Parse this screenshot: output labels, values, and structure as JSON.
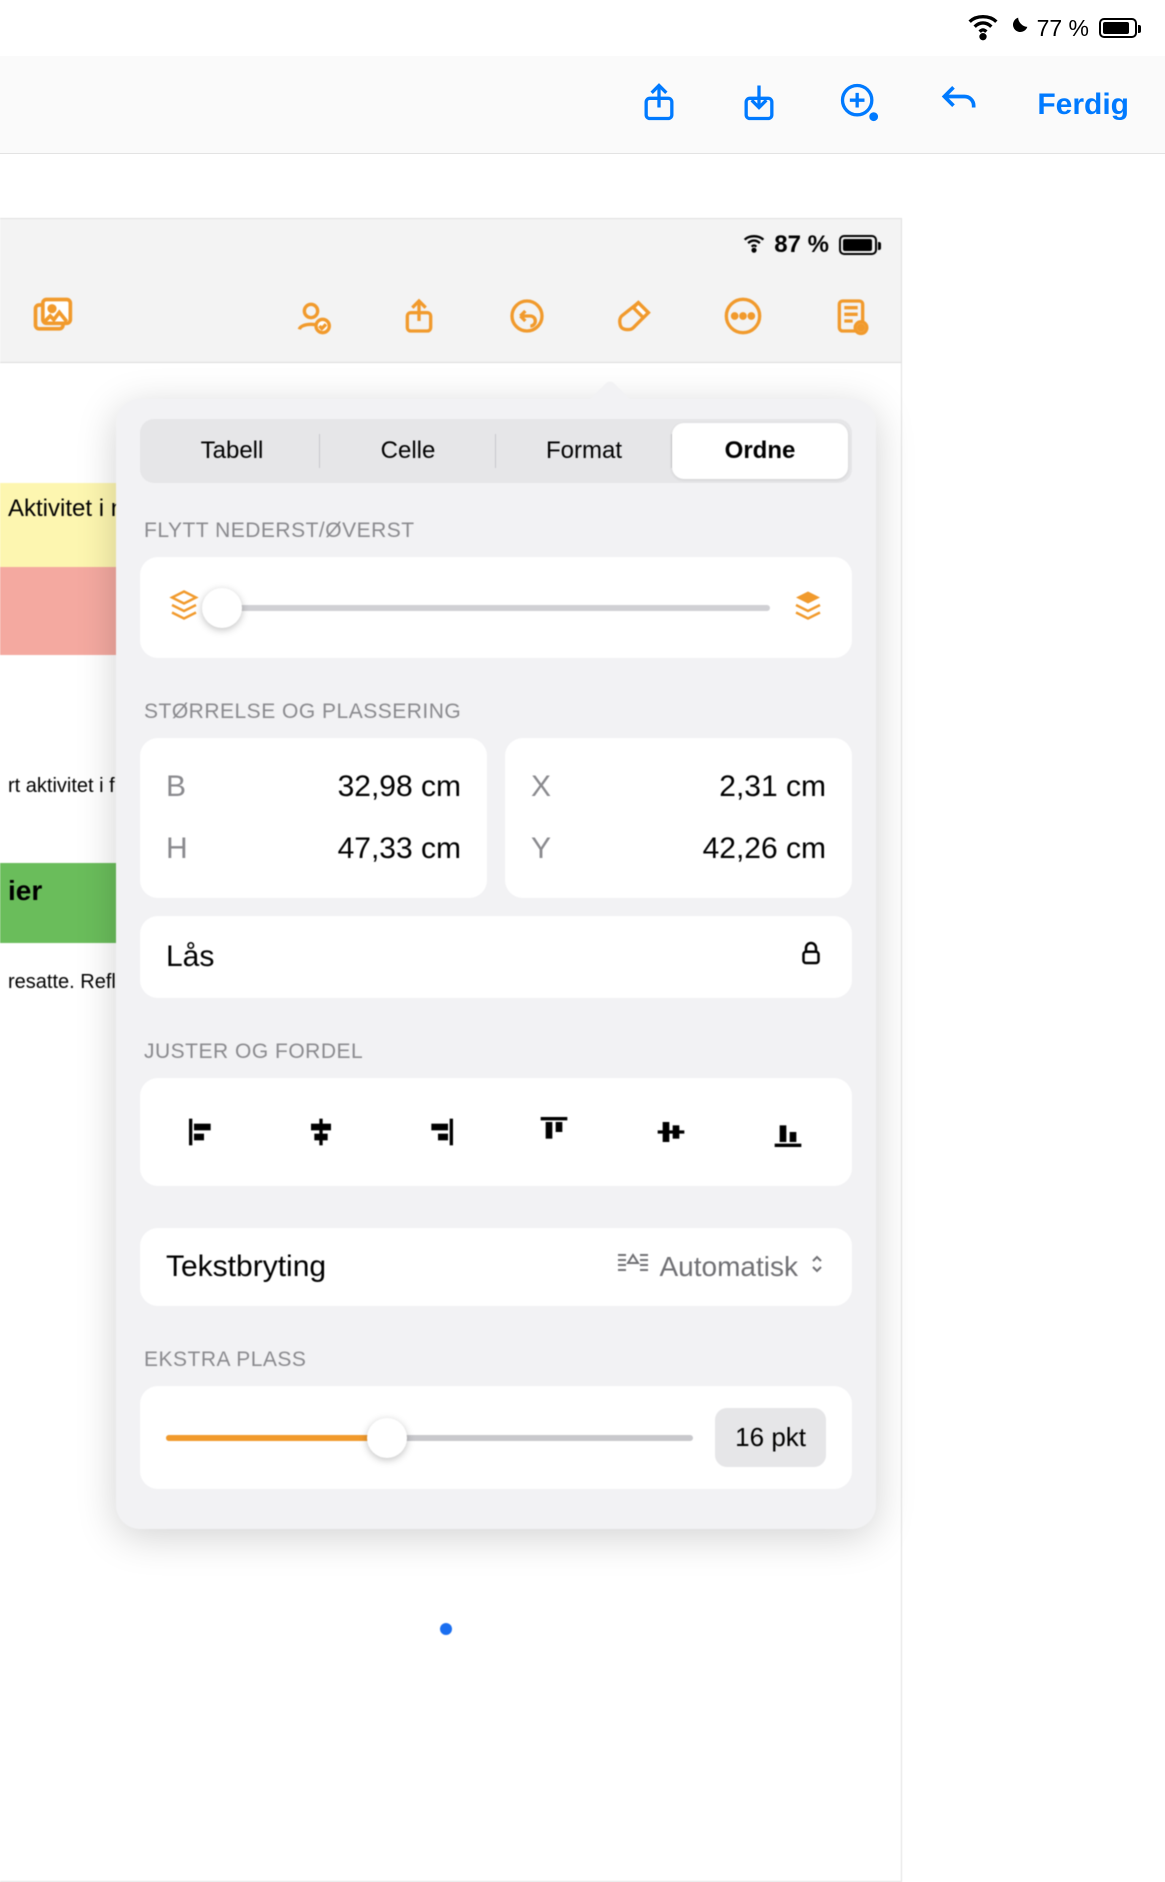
{
  "outer": {
    "battery_pct": "77 %",
    "done_label": "Ferdig"
  },
  "inner": {
    "battery_pct": "87 %"
  },
  "popover": {
    "tabs": [
      "Tabell",
      "Celle",
      "Format",
      "Ordne"
    ],
    "selected_tab_index": 3,
    "move_section_label": "FLYTT NEDERST/ØVERST",
    "size_section_label": "STØRRELSE OG PLASSERING",
    "size": {
      "width_key": "B",
      "width_val": "32,98 cm",
      "height_key": "H",
      "height_val": "47,33 cm",
      "x_key": "X",
      "x_val": "2,31 cm",
      "y_key": "Y",
      "y_val": "42,26 cm"
    },
    "lock_label": "Lås",
    "align_section_label": "JUSTER OG FORDEL",
    "wrap_label": "Tekstbryting",
    "wrap_value": "Automatisk",
    "extra_section_label": "EKSTRA PLASS",
    "extra_value": "16 pkt"
  },
  "bg_fragments": {
    "f1": "Aktivitet i na",
    "f3": "rt aktivitet i fri",
    "f4": "ier",
    "f5": "resatte. Refle"
  }
}
